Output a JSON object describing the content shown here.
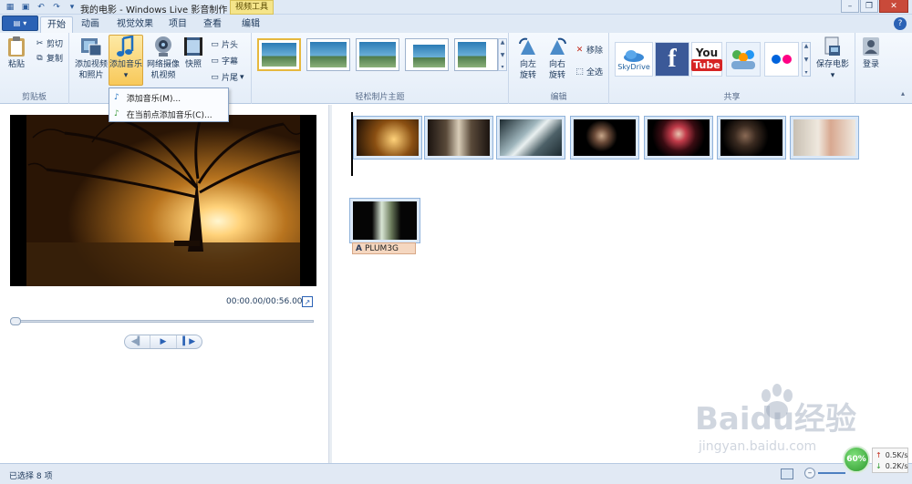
{
  "window": {
    "title": "我的电影 - Windows Live 影音制作",
    "contextual_tab_group": "视频工具"
  },
  "tabs": [
    {
      "label": "开始"
    },
    {
      "label": "动画"
    },
    {
      "label": "视觉效果"
    },
    {
      "label": "项目"
    },
    {
      "label": "查看"
    },
    {
      "label": "编辑"
    }
  ],
  "ribbon": {
    "clipboard": {
      "group_label": "剪贴板",
      "paste": "粘贴",
      "cut": "剪切",
      "copy": "复制"
    },
    "add": {
      "add_video_line1": "添加视频",
      "add_video_line2": "和照片",
      "add_music": "添加音乐",
      "webcam_line1": "网络摄像",
      "webcam_line2": "机视频",
      "snapshot": "快照",
      "title": "片头",
      "caption": "字幕",
      "credits": "片尾"
    },
    "themes": {
      "group_label": "轻松制片主题"
    },
    "editing": {
      "group_label": "编辑",
      "rotate_left_line1": "向左",
      "rotate_left_line2": "旋转",
      "rotate_right_line1": "向右",
      "rotate_right_line2": "旋转",
      "remove": "移除",
      "select_all": "全选"
    },
    "share": {
      "group_label": "共享",
      "skydrive": "SkyDrive",
      "youtube_line1": "You",
      "youtube_line2": "Tube",
      "save_movie": "保存电影",
      "sign_in": "登录"
    }
  },
  "music_menu": {
    "items": [
      {
        "label": "添加音乐(M)..."
      },
      {
        "label": "在当前点添加音乐(C)..."
      }
    ]
  },
  "preview": {
    "time": "00:00.00/00:56.00",
    "progress": 0.0
  },
  "storyboard": {
    "clips_row1": 7,
    "caption_text": "PLUM3G"
  },
  "status": {
    "selected_text": "已选择 8 项"
  },
  "network_widget": {
    "percent": "60%",
    "up": "0.5K/s",
    "down": "0.2K/s"
  },
  "watermark": {
    "main": "Baidu经验",
    "sub": "jingyan.baidu.com"
  },
  "colors": {
    "accent": "#2b62b5",
    "ribbon_bg": "#e4edf8",
    "highlight": "#f8c95a",
    "contextual": "#f5e58a"
  }
}
